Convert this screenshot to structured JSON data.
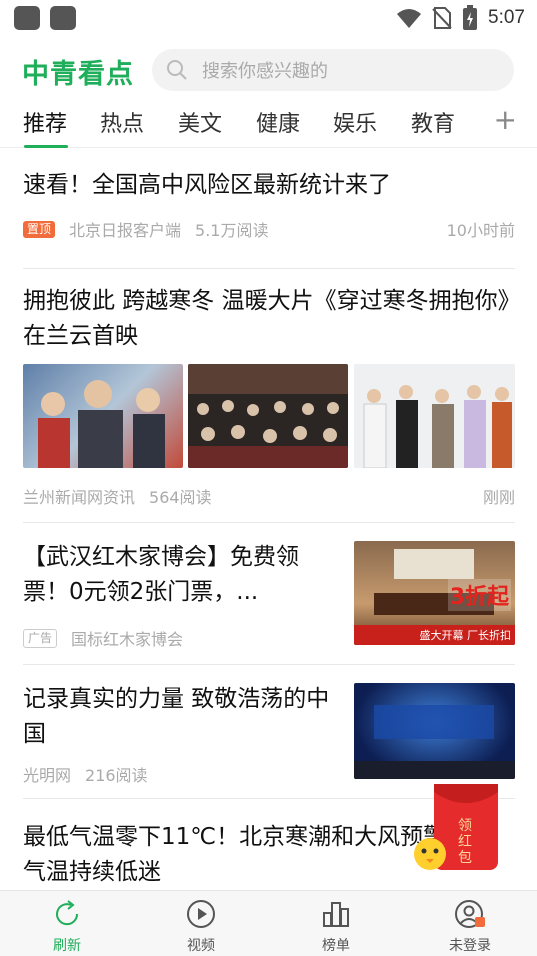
{
  "status_bar": {
    "time": "5:07"
  },
  "header": {
    "logo": "中青看点",
    "search_placeholder": "搜索你感兴趣的"
  },
  "tabs": [
    "推荐",
    "热点",
    "美文",
    "健康",
    "娱乐",
    "教育"
  ],
  "feed": [
    {
      "title": "速看！全国高中风险区最新统计来了",
      "tag": "置顶",
      "source": "北京日报客户端",
      "reads": "5.1万阅读",
      "time": "10小时前"
    },
    {
      "title": "拥抱彼此 跨越寒冬 温暖大片《穿过寒冬拥抱你》在兰云首映",
      "source": "兰州新闻网资讯",
      "reads": "564阅读",
      "time": "刚刚"
    },
    {
      "title": "【武汉红木家博会】免费领票！0元领2张门票，...",
      "tag": "广告",
      "source": "国标红木家博会",
      "ad_text_1": "3折起",
      "ad_text_2": "盛大开幕 厂长折扣"
    },
    {
      "title": "记录真实的力量 致敬浩荡的中国",
      "source": "光明网",
      "reads": "216阅读"
    },
    {
      "title": "最低气温零下11℃！北京寒潮和大风预警中，气温持续低迷"
    }
  ],
  "red_packet": {
    "label": "领红包"
  },
  "bottom_nav": [
    {
      "label": "刷新",
      "icon": "refresh-icon"
    },
    {
      "label": "视频",
      "icon": "play-icon"
    },
    {
      "label": "榜单",
      "icon": "ranking-icon"
    },
    {
      "label": "未登录",
      "icon": "user-icon"
    }
  ],
  "colors": {
    "accent": "#1fae5a",
    "top_tag": "#f26b3a",
    "red_packet": "#e52b2b"
  }
}
